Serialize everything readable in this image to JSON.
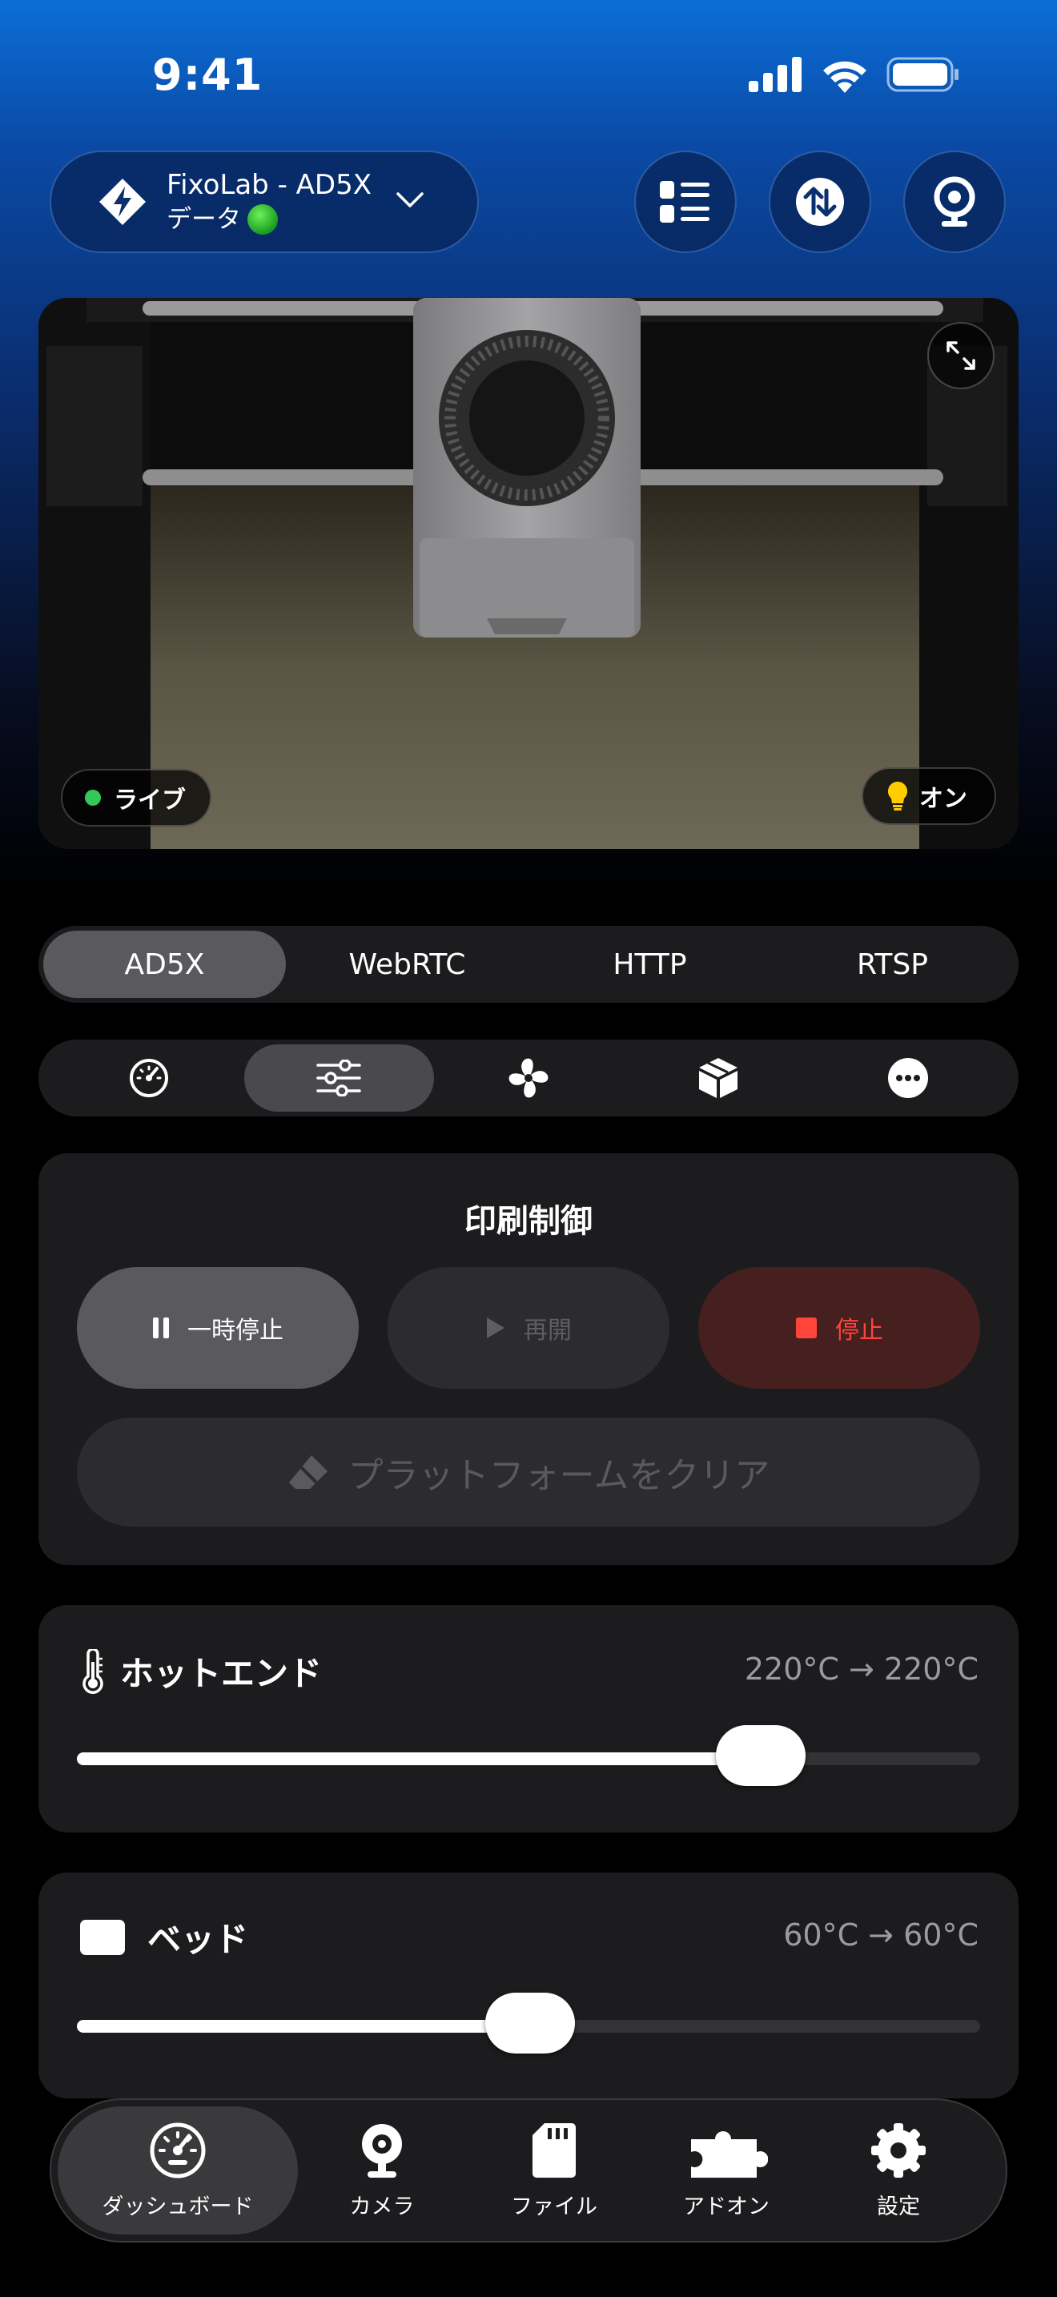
{
  "status_bar": {
    "time": "9:41"
  },
  "header": {
    "printer_name": "FixoLab - AD5X",
    "printer_subtitle": "データ"
  },
  "camera": {
    "live_label": "ライブ",
    "light_label": "オン",
    "live_color": "#34c759",
    "light_color": "#ffcc00"
  },
  "stream_tabs": [
    "AD5X",
    "WebRTC",
    "HTTP",
    "RTSP"
  ],
  "active_stream_tab": "AD5X",
  "tool_tabs": [
    "dashboard-gauge-icon",
    "sliders-icon",
    "fan-icon",
    "cube-icon",
    "more-icon"
  ],
  "active_tool_tab": "sliders-icon",
  "print_control": {
    "title": "印刷制御",
    "pause_label": "一時停止",
    "resume_label": "再開",
    "stop_label": "停止",
    "clear_label": "プラットフォームをクリア",
    "stop_color": "#ff453a"
  },
  "hotend": {
    "label": "ホットエンド",
    "value": "220°C → 220°C",
    "level_percent": 76
  },
  "bed": {
    "label": "ベッド",
    "value": "60°C → 60°C",
    "level_percent": 50
  },
  "bottom_nav": {
    "dashboard": "ダッシュボード",
    "camera": "カメラ",
    "files": "ファイル",
    "addons": "アドオン",
    "settings": "設定"
  }
}
